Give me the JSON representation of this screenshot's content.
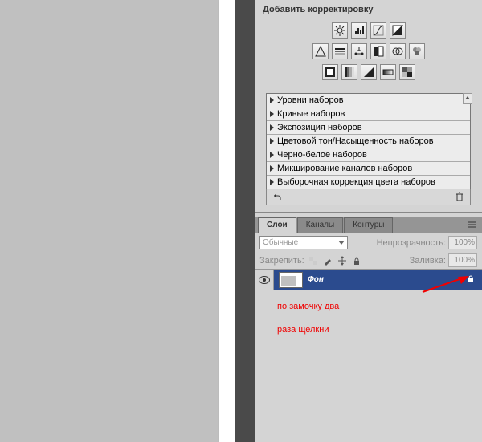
{
  "adjustments": {
    "title": "Добавить корректировку",
    "icons_row1": [
      "brightness-icon",
      "levels-icon",
      "curves-icon",
      "exposure-icon"
    ],
    "icons_row2": [
      "vibrance-icon",
      "hue-sat-icon",
      "color-balance-icon",
      "bw-icon",
      "photo-filter-icon",
      "channel-mixer-icon"
    ],
    "icons_row3": [
      "invert-icon",
      "posterize-icon",
      "threshold-icon",
      "gradient-map-icon",
      "selective-color-icon"
    ],
    "presets": [
      "Уровни наборов",
      "Кривые наборов",
      "Экспозиция наборов",
      "Цветовой тон/Насыщенность наборов",
      "Черно-белое наборов",
      "Микширование каналов наборов",
      "Выборочная коррекция цвета наборов"
    ]
  },
  "layers": {
    "tabs": [
      "Слои",
      "Каналы",
      "Контуры"
    ],
    "active_tab": 0,
    "blend_mode": "Обычные",
    "opacity_label": "Непрозрачность:",
    "opacity_value": "100%",
    "lock_label": "Закрепить:",
    "fill_label": "Заливка:",
    "fill_value": "100%",
    "layer_name": "Фон"
  },
  "annotation": {
    "text": "по замочку два\nраза щелкни"
  }
}
